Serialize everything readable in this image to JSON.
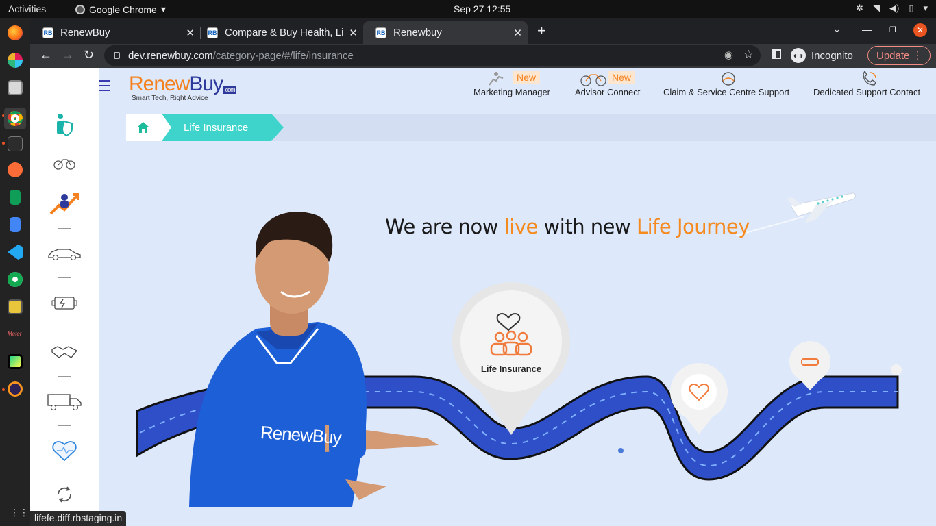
{
  "system_bar": {
    "activities": "Activities",
    "app_name": "Google Chrome",
    "clock": "Sep 27  12:55"
  },
  "dock": {
    "apps": [
      "firefox-icon",
      "slack-icon",
      "files-icon",
      "chrome-icon",
      "terminal-icon",
      "postman-icon",
      "sheets-icon",
      "docs-icon",
      "vscode-icon",
      "mongodb-icon",
      "game-icon",
      "meter-icon",
      "pycharm-icon",
      "eclipse-icon"
    ]
  },
  "browser": {
    "tabs": [
      {
        "favicon": "RB",
        "title": "RenewBuy",
        "close": "✕"
      },
      {
        "favicon": "RB",
        "title": "Compare & Buy Health, Li",
        "close": "✕"
      },
      {
        "favicon": "RB",
        "title": "Renewbuy",
        "close": "✕"
      }
    ],
    "new_tab": "+",
    "url_host": "dev.renewbuy.com",
    "url_path": "/category-page/#/life/insurance",
    "incognito_label": "Incognito",
    "update_label": "Update",
    "status_url": "lifefe.diff.rbstaging.in"
  },
  "site": {
    "logo": {
      "renew": "Renew",
      "buy": "Buy",
      "com": ".com",
      "tagline": "Smart Tech, Right Advice"
    },
    "header_links": [
      {
        "label": "Marketing Manager",
        "badge": "New"
      },
      {
        "label": "Advisor Connect",
        "badge": "New"
      },
      {
        "label": "Claim & Service Centre Support",
        "badge": ""
      },
      {
        "label": "Dedicated Support Contact",
        "badge": ""
      }
    ],
    "breadcrumb": {
      "current": "Life Insurance"
    },
    "headline": {
      "part1": "We are now ",
      "live": "live",
      "part2": " with new ",
      "life_journey": "Life Journey"
    },
    "hero": {
      "pin_label": "Life Insurance",
      "shirt_text": "RenewBuy"
    }
  },
  "colors": {
    "brand_orange": "#f58220",
    "brand_blue": "#2d3a9b",
    "page_bg": "#dde8fb",
    "breadcrumb_teal": "#3ed4cc",
    "road_blue": "#2f4fc9"
  }
}
